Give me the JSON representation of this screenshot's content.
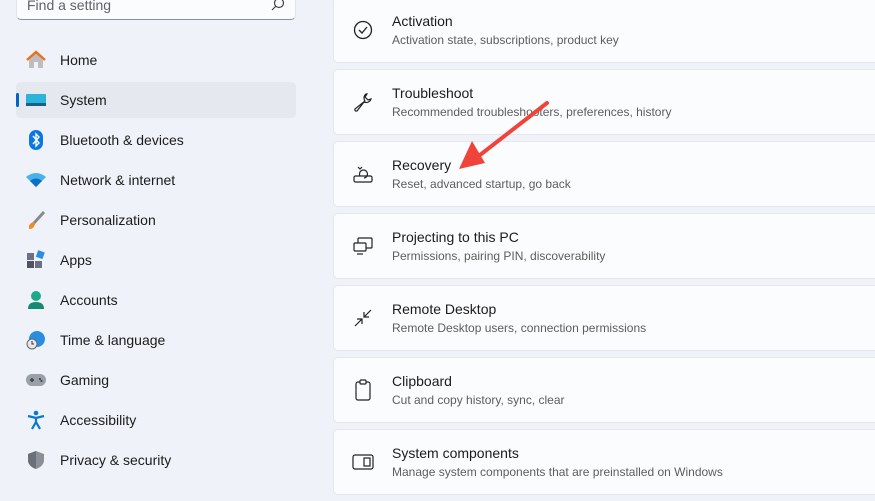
{
  "search": {
    "placeholder": "Find a setting"
  },
  "sidebar": {
    "items": [
      {
        "label": "Home",
        "icon": "home-icon"
      },
      {
        "label": "System",
        "icon": "system-icon",
        "selected": true
      },
      {
        "label": "Bluetooth & devices",
        "icon": "bluetooth-icon"
      },
      {
        "label": "Network & internet",
        "icon": "wifi-icon"
      },
      {
        "label": "Personalization",
        "icon": "brush-icon"
      },
      {
        "label": "Apps",
        "icon": "apps-icon"
      },
      {
        "label": "Accounts",
        "icon": "accounts-icon"
      },
      {
        "label": "Time & language",
        "icon": "globe-clock-icon"
      },
      {
        "label": "Gaming",
        "icon": "gamepad-icon"
      },
      {
        "label": "Accessibility",
        "icon": "accessibility-icon"
      },
      {
        "label": "Privacy & security",
        "icon": "shield-icon"
      }
    ]
  },
  "main": {
    "cards": [
      {
        "title": "Activation",
        "subtitle": "Activation state, subscriptions, product key",
        "icon": "check-circle-icon"
      },
      {
        "title": "Troubleshoot",
        "subtitle": "Recommended troubleshooters, preferences, history",
        "icon": "wrench-icon"
      },
      {
        "title": "Recovery",
        "subtitle": "Reset, advanced startup, go back",
        "icon": "recovery-icon"
      },
      {
        "title": "Projecting to this PC",
        "subtitle": "Permissions, pairing PIN, discoverability",
        "icon": "projecting-icon"
      },
      {
        "title": "Remote Desktop",
        "subtitle": "Remote Desktop users, connection permissions",
        "icon": "remote-desktop-icon"
      },
      {
        "title": "Clipboard",
        "subtitle": "Cut and copy history, sync, clear",
        "icon": "clipboard-icon"
      },
      {
        "title": "System components",
        "subtitle": "Manage system components that are preinstalled on Windows",
        "icon": "system-components-icon"
      }
    ]
  },
  "annotation": {
    "color": "#f0443a"
  }
}
